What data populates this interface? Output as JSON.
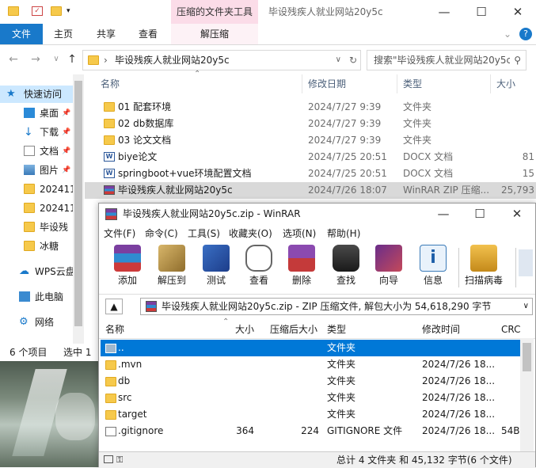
{
  "explorer": {
    "title": "毕设残疾人就业网站20y5c",
    "contextual_tab": "压缩的文件夹工具",
    "contextual_subtab": "解压缩",
    "ribbon_tabs": [
      "文件",
      "主页",
      "共享",
      "查看"
    ],
    "address": "毕设残疾人就业网站20y5c",
    "search_placeholder": "搜索\"毕设残疾人就业网站20y5c\"",
    "nav_items": [
      "快速访问",
      "桌面",
      "下载",
      "文档",
      "图片",
      "202411",
      "202411",
      "毕设残",
      "冰糖",
      "WPS云盘",
      "此电脑",
      "网络"
    ],
    "columns": {
      "name": "名称",
      "date": "修改日期",
      "type": "类型",
      "size": "大小"
    },
    "files": [
      {
        "name": "01 配套环境",
        "date": "2024/7/27 9:39",
        "type": "文件夹",
        "size": ""
      },
      {
        "name": "02 db数据库",
        "date": "2024/7/27 9:39",
        "type": "文件夹",
        "size": ""
      },
      {
        "name": "03 论文文档",
        "date": "2024/7/27 9:39",
        "type": "文件夹",
        "size": ""
      },
      {
        "name": "biye论文",
        "date": "2024/7/25 20:51",
        "type": "DOCX 文档",
        "size": "81"
      },
      {
        "name": "springboot+vue环境配置文档",
        "date": "2024/7/25 20:51",
        "type": "DOCX 文档",
        "size": "15"
      },
      {
        "name": "毕设残疾人就业网站20y5c",
        "date": "2024/7/26 18:07",
        "type": "WinRAR ZIP 压缩...",
        "size": "25,793"
      }
    ],
    "status_count": "6 个项目",
    "status_selected": "选中 1"
  },
  "winrar": {
    "title": "毕设残疾人就业网站20y5c.zip - WinRAR",
    "menu": [
      "文件(F)",
      "命令(C)",
      "工具(S)",
      "收藏夹(O)",
      "选项(N)",
      "帮助(H)"
    ],
    "toolbar": [
      "添加",
      "解压到",
      "测试",
      "查看",
      "删除",
      "查找",
      "向导",
      "信息",
      "扫描病毒"
    ],
    "path": "毕设残疾人就业网站20y5c.zip - ZIP 压缩文件, 解包大小为 54,618,290 字节",
    "columns": {
      "name": "名称",
      "size": "大小",
      "packed": "压缩后大小",
      "type": "类型",
      "modified": "修改时间",
      "crc": "CRC"
    },
    "rows": [
      {
        "name": "..",
        "size": "",
        "packed": "",
        "type": "文件夹",
        "modified": "",
        "crc": ""
      },
      {
        "name": ".mvn",
        "size": "",
        "packed": "",
        "type": "文件夹",
        "modified": "2024/7/26 18...",
        "crc": ""
      },
      {
        "name": "db",
        "size": "",
        "packed": "",
        "type": "文件夹",
        "modified": "2024/7/26 18...",
        "crc": ""
      },
      {
        "name": "src",
        "size": "",
        "packed": "",
        "type": "文件夹",
        "modified": "2024/7/26 18...",
        "crc": ""
      },
      {
        "name": "target",
        "size": "",
        "packed": "",
        "type": "文件夹",
        "modified": "2024/7/26 18...",
        "crc": ""
      },
      {
        "name": ".gitignore",
        "size": "364",
        "packed": "224",
        "type": "GITIGNORE 文件",
        "modified": "2024/7/26 18...",
        "crc": "54B"
      }
    ],
    "status": "总计 4 文件夹 和 45,132 字节(6 个文件)"
  }
}
